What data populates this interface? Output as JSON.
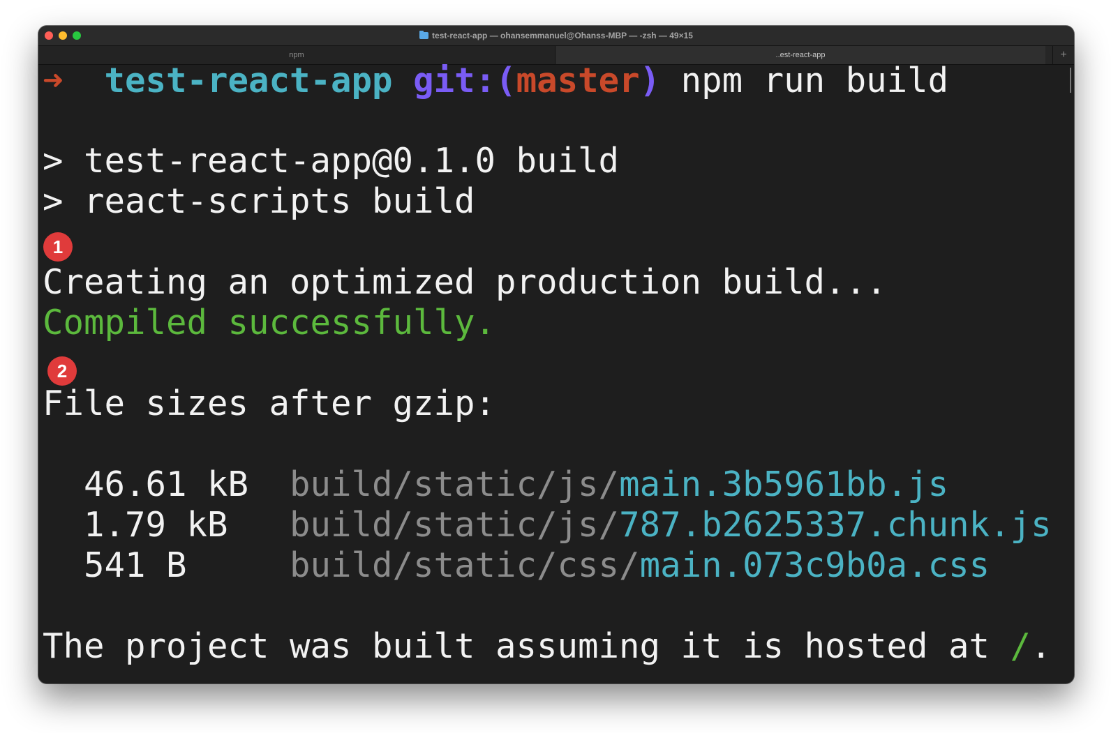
{
  "window": {
    "title": "test-react-app — ohansemmanuel@Ohanss-MBP — -zsh — 49×15",
    "title_icon": "folder-icon",
    "traffic_lights": {
      "close": "#ff5f57",
      "minimize": "#febc2e",
      "maximize": "#28c840"
    }
  },
  "tabs": [
    {
      "label": "npm",
      "active": false
    },
    {
      "label": "..est-react-app",
      "active": true
    }
  ],
  "tab_add_label": "+",
  "prompt": {
    "arrow": "➜",
    "directory": "test-react-app",
    "git_label": "git:(",
    "branch": "master",
    "git_close": ")",
    "command": "npm run build"
  },
  "output": {
    "script_line_1": "> test-react-app@0.1.0 build",
    "script_line_2": "> react-scripts build",
    "creating": "Creating an optimized production build...",
    "compiled": "Compiled successfully.",
    "file_sizes_header": "File sizes after gzip:",
    "files": [
      {
        "size": "46.61 kB",
        "dir": "build/static/js/",
        "name": "main.3b5961bb.js"
      },
      {
        "size": "1.79 kB",
        "dir": "build/static/js/",
        "name": "787.b2625337.chunk.js"
      },
      {
        "size": "541 B",
        "dir": "build/static/css/",
        "name": "main.073c9b0a.css"
      }
    ],
    "hosted_prefix": "The project was built assuming it is hosted at ",
    "hosted_path": "/",
    "hosted_suffix": "."
  },
  "annotations": [
    "1",
    "2"
  ],
  "colors": {
    "background": "#1e1e1e",
    "text": "#f2f2f2",
    "directory": "#4bb3c4",
    "git": "#7a5cf5",
    "branch": "#c9492a",
    "success": "#5cb93d",
    "path_dim": "#8c8c8c",
    "badge": "#e03b3b"
  }
}
